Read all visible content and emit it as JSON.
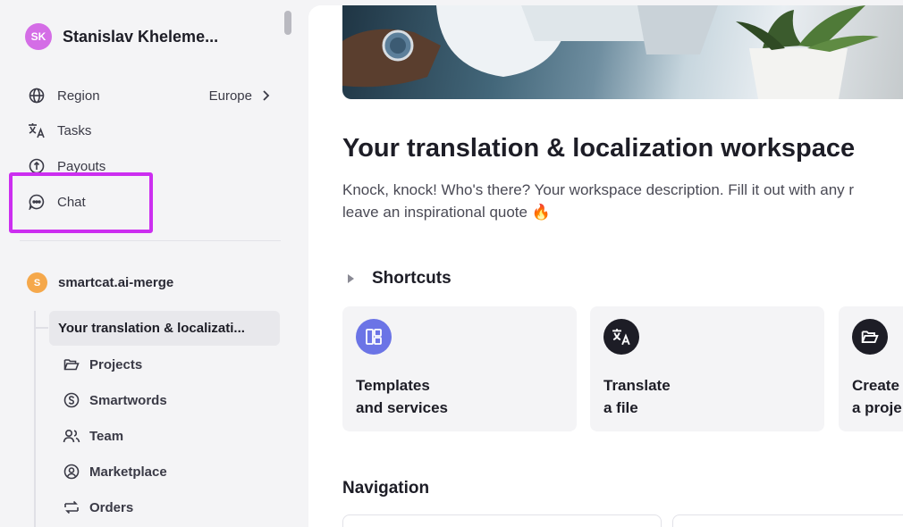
{
  "user": {
    "initials": "SK",
    "name": "Stanislav Kheleme..."
  },
  "sidebar": {
    "items": [
      {
        "label": "Region",
        "value": "Europe",
        "icon": "globe-icon"
      },
      {
        "label": "Tasks",
        "icon": "translate-icon"
      },
      {
        "label": "Payouts",
        "icon": "payout-icon"
      },
      {
        "label": "Chat",
        "icon": "chat-icon"
      }
    ],
    "workspace": {
      "initial": "S",
      "name": "smartcat.ai-merge"
    },
    "active_item": "Your translation & localizati...",
    "sub_items": [
      {
        "label": "Projects",
        "icon": "folder-icon"
      },
      {
        "label": "Smartwords",
        "icon": "smartwords-icon"
      },
      {
        "label": "Team",
        "icon": "team-icon"
      },
      {
        "label": "Marketplace",
        "icon": "marketplace-icon"
      },
      {
        "label": "Orders",
        "icon": "orders-icon"
      }
    ]
  },
  "main": {
    "title": "Your translation & localization workspace",
    "description_line1": "Knock, knock! Who's there? Your workspace description. Fill it out with any r",
    "description_line2": "leave an inspirational quote 🔥",
    "shortcuts_title": "Shortcuts",
    "cards": [
      {
        "line1": "Templates",
        "line2": "and services",
        "icon": "templates-icon"
      },
      {
        "line1": "Translate",
        "line2": "a file",
        "icon": "translate-icon"
      },
      {
        "line1": "Create",
        "line2": "a proje",
        "icon": "folder-icon"
      }
    ],
    "navigation_title": "Navigation"
  },
  "colors": {
    "highlight": "#cc2ef0",
    "avatar": "#d46de6",
    "workspace_dot": "#f5a84b",
    "templates_icon_bg": "#6b74e6",
    "dark_icon_bg": "#1d1d26"
  }
}
